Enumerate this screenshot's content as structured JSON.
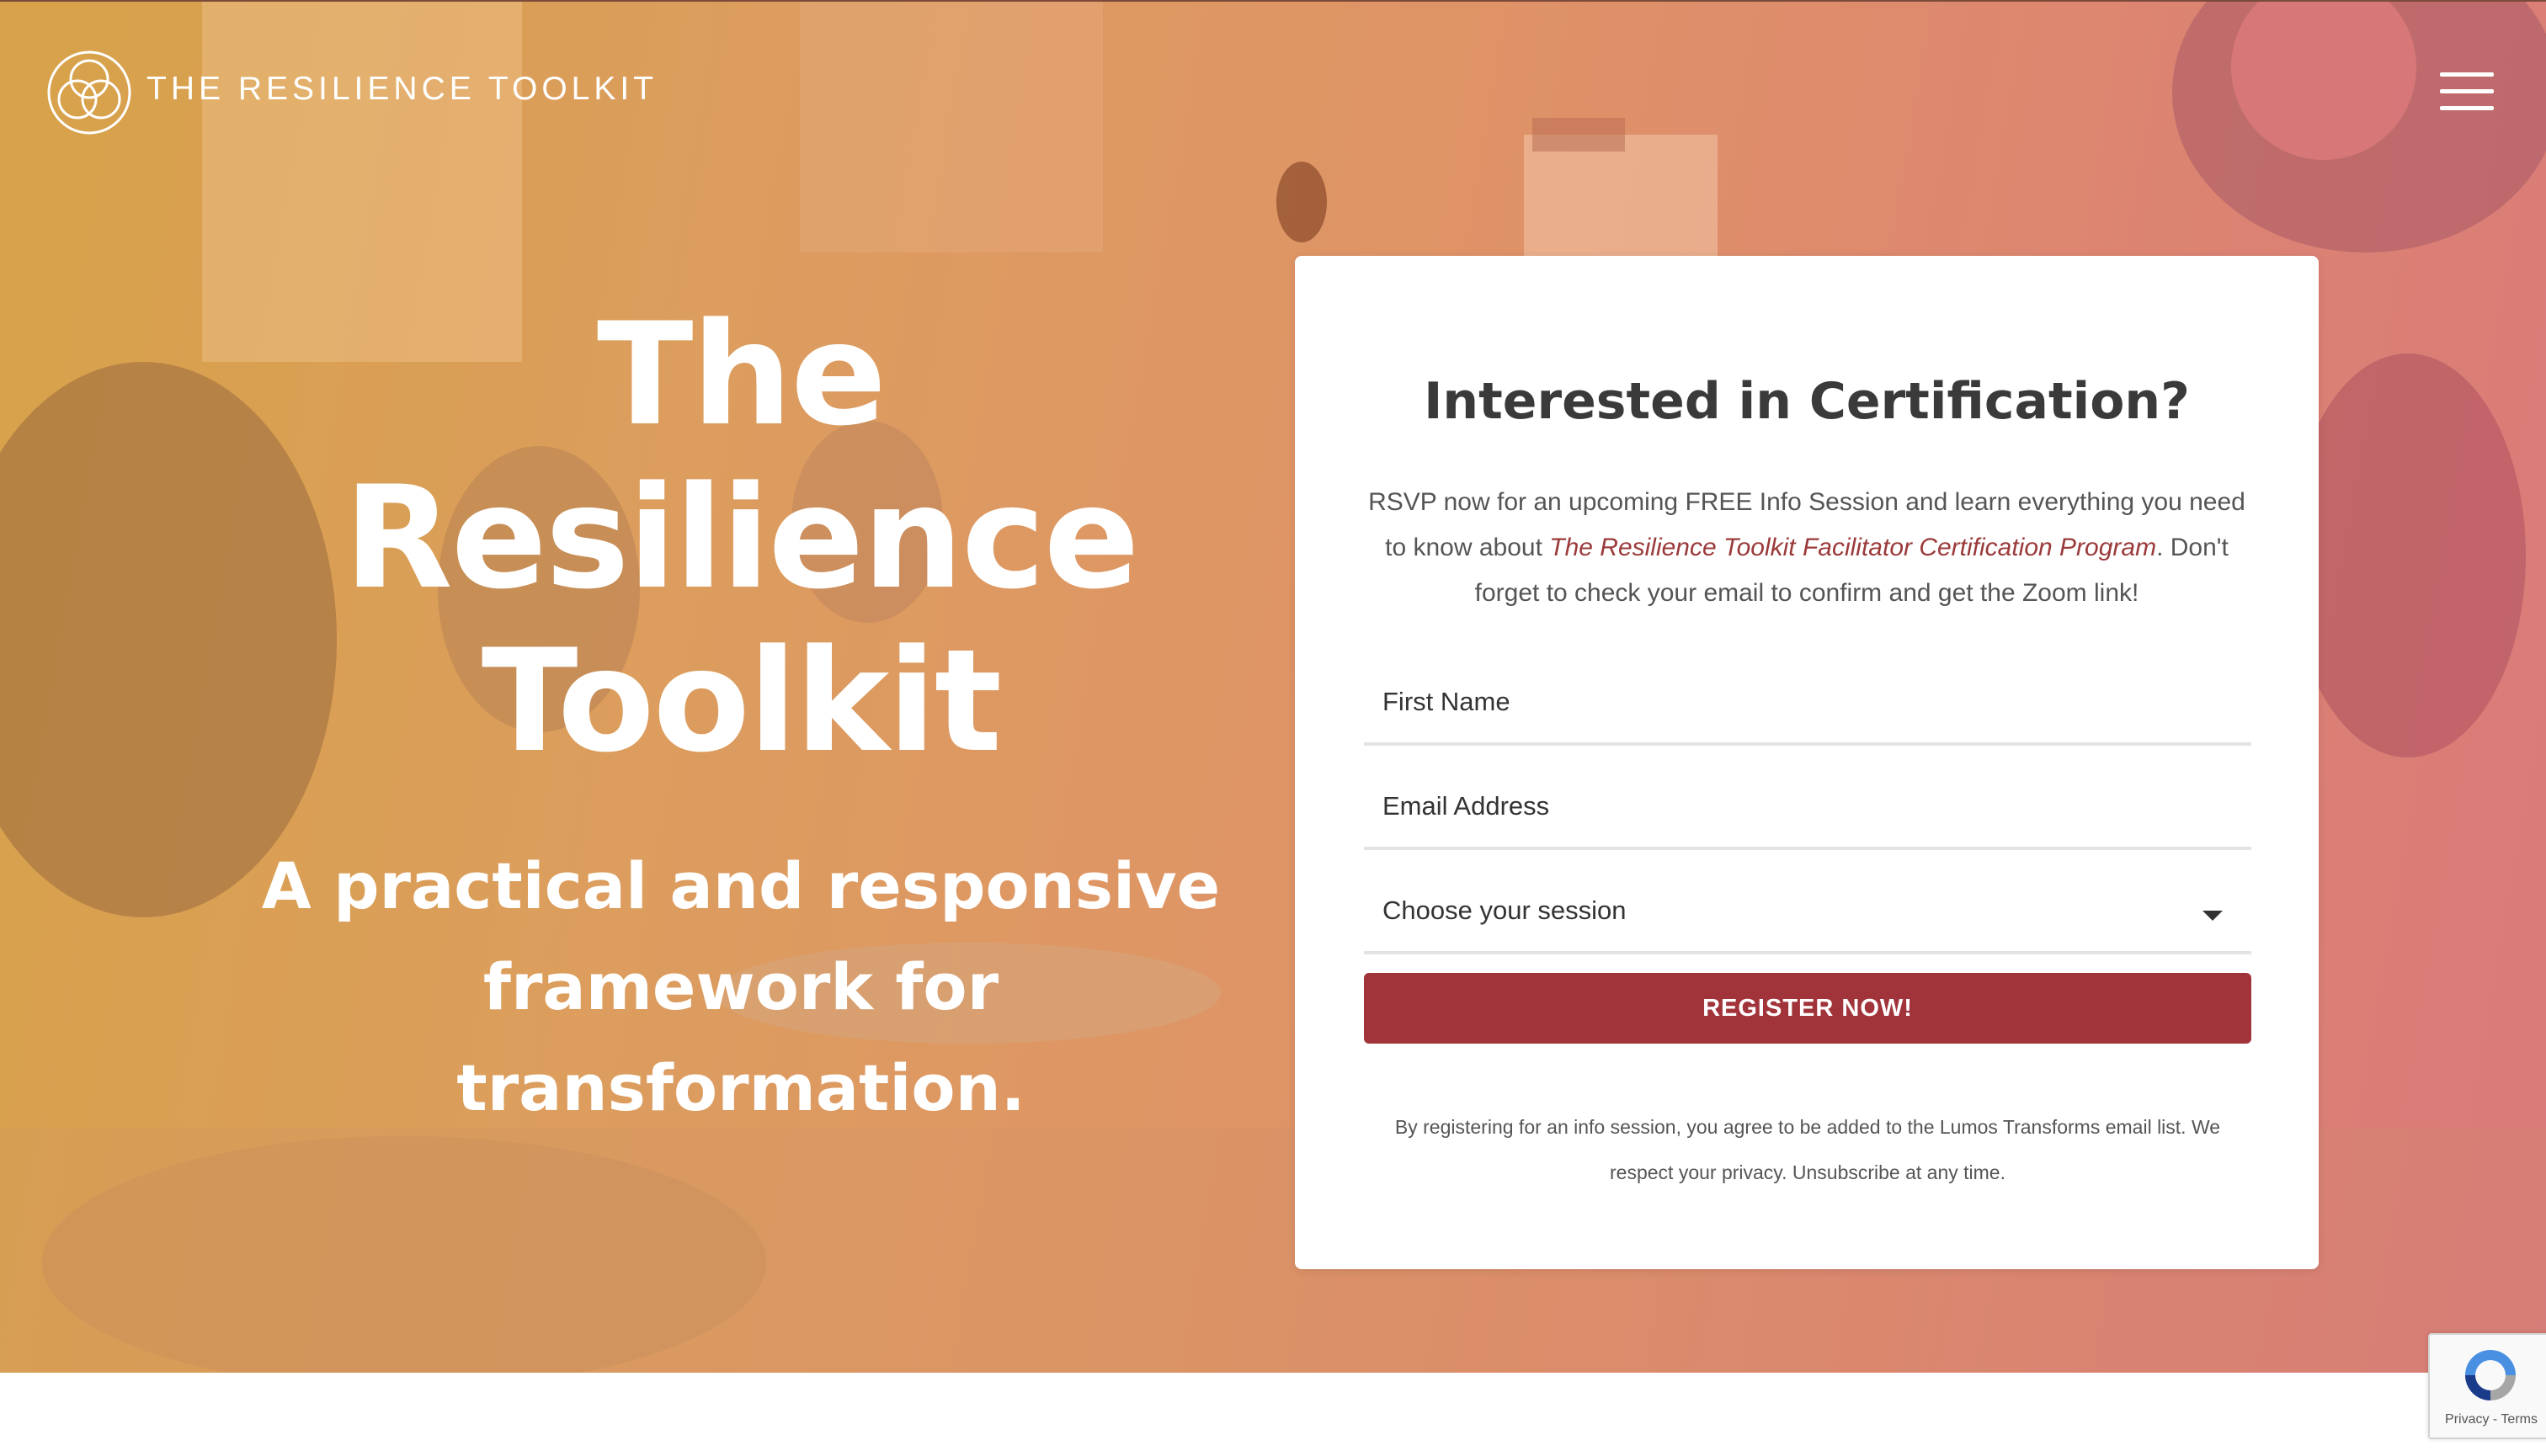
{
  "header": {
    "brand": "THE RESILIENCE TOOLKIT"
  },
  "hero": {
    "title_lines": [
      "The",
      "Resilience",
      "Toolkit"
    ],
    "subtitle_lines": [
      "A practical and responsive",
      "framework for",
      "transformation."
    ]
  },
  "form": {
    "title": "Interested in Certification?",
    "description": {
      "part1": "RSVP now for an upcoming FREE Info Session and learn everything you need to know about ",
      "emphasis": "The Resilience Toolkit Facilitator Certification Program",
      "part2": ". Don't forget to check your email to confirm and get the Zoom link!"
    },
    "first_name_placeholder": "First Name",
    "email_placeholder": "Email Address",
    "session_select": "Choose your session",
    "register_label": "REGISTER NOW!",
    "disclaimer": "By registering for an info session, you agree to be added to the Lumos Transforms email list. We respect your privacy. Unsubscribe at any time."
  },
  "recaptcha": {
    "links": "Privacy - Terms"
  },
  "colors": {
    "accent": "#a1343a",
    "emphasis_text": "#9b3a3a"
  },
  "icons": {
    "logo": "triple-circle-logo-icon",
    "menu": "hamburger-menu-icon",
    "select": "caret-down-icon",
    "recaptcha": "recaptcha-icon"
  }
}
